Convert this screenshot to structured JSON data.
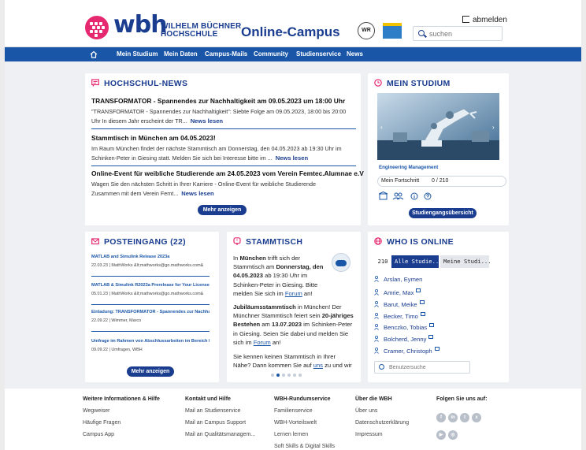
{
  "header": {
    "logo_text": "wbh",
    "logo_sub_line1": "WILHELM BÜCHNER",
    "logo_sub_line2": "HOCHSCHULE",
    "campus_title": "Online-Campus",
    "wr_badge": "WR",
    "logout_label": "abmelden",
    "search_placeholder": "suchen"
  },
  "nav": {
    "items": [
      "Mein Studium",
      "Mein Daten",
      "Campus-Mails",
      "Community",
      "Studienservice",
      "News"
    ]
  },
  "news": {
    "title": "HOCHSCHUL-NEWS",
    "items": [
      {
        "headline": "TRANSFORMATOR - Spannendes zur Nachhaltigkeit am 09.05.2023 um 18:00 Uhr",
        "line1": "\"TRANSFORMATOR - Spannendes zur Nachhaltigkeit\": Siebte Folge am 09.05.2023, 18:00 bis 20:00",
        "line2": "Uhr In diesem Jahr erscheint der TR...",
        "link": "News lesen"
      },
      {
        "headline": "Stammtisch in München am 04.05.2023!",
        "line1": "Im Raum München findet der nächste Stammtisch am Donnerstag, den 04.05.2023 ab 19:30 Uhr im",
        "line2": "Schinken-Peter in Giesing statt. Melden Sie sich bei Interesse bitte im ...",
        "link": "News lesen"
      },
      {
        "headline": "Online-Event für weibliche Studierende am 24.05.2023 vom Verein Femtec.Alumnae e.V",
        "line1": "Wagen Sie den nächsten Schritt in Ihrer Karriere - Online-Event für weibliche Studierende",
        "line2": "Zusammen mit dem Verein Femt...",
        "link": "News lesen"
      }
    ],
    "more_button": "Mehr anzeigen"
  },
  "studium": {
    "title": "MEIN STUDIUM",
    "program": "Engineering Management",
    "progress_label": "Mein Fortschritt",
    "progress_value": "0 / 210",
    "progress_fraction": 0.0,
    "overview_button": "Studiengangsübersicht"
  },
  "mail": {
    "title": "POSTEINGANG (22)",
    "items": [
      {
        "subject": "MATLAB and Simulink Release 2023a",
        "meta": "22.03.23 | MathWorks &lt;mathworks@go.mathworks.com&"
      },
      {
        "subject": "MATLAB & Simulink R2023a Prerelease for Your License",
        "meta": "05.01.23 | MathWorks &lt;mathworks@go.mathworks.com&"
      },
      {
        "subject": "Einladung: TRANSFORMATOR - Spannendes zur Nachhalt...",
        "meta": "22.09.22 | Wimmer, Marco"
      },
      {
        "subject": "Umfrage im Rahmen von Abschlussarbeiten im Bereich I...",
        "meta": "09.09.22 | Umfragen, WBH"
      }
    ],
    "more_button": "Mehr anzeigen"
  },
  "stammtisch": {
    "title": "STAMMTISCH",
    "p1_a": "In ",
    "p1_city": "München",
    "p1_b": " trifft sich der Stammtisch am ",
    "p1_date": "Donnerstag, den 04.05.2023",
    "p1_c": " ab 19:30 Uhr im Schinken-Peter in Giesing. Bitte melden Sie sich im ",
    "p1_link": "Forum",
    "p1_d": " an!",
    "p2_a": "Jubiläumsstammtisch",
    "p2_b": " in München! Der Münchner Stammtisch feiert sein ",
    "p2_c": "20-jähriges Bestehen",
    "p2_d": " am ",
    "p2_date": "13.07.2023",
    "p2_e": " im Schinken-Peter in Giesing. Seien Sie dabei und melden Sie sich im ",
    "p2_link": "Forum",
    "p2_f": " an!",
    "p3_a": "Sie kennen keinen Stammtisch in Ihrer Nähe? Dann kommen Sie auf ",
    "p3_link": "uns",
    "p3_b": " zu und wir"
  },
  "online": {
    "title": "WHO IS ONLINE",
    "count": "210",
    "tab_all": "Alle Studie...",
    "tab_mine": "Meine Studi...",
    "users": [
      "Arslan, Eymen",
      "Amrie, Max",
      "Barut, Meike",
      "Becker, Timo",
      "Benczko, Tobias",
      "Bolcherd, Jenny",
      "Cramer, Christoph"
    ],
    "search_placeholder": "Benutzersuche"
  },
  "footer": {
    "col1": {
      "heading": "Weitere Informationen & Hilfe",
      "links": [
        "Wegweiser",
        "Häufige Fragen",
        "Campus App"
      ]
    },
    "col2": {
      "heading": "Kontakt und Hilfe",
      "links": [
        "Mail an Studienservice",
        "Mail an Campus Support",
        "Mail an Qualitätsmanagem..."
      ]
    },
    "col3": {
      "heading": "WBH-Rundumservice",
      "links": [
        "Familienservice",
        "WBH-Vorteilswelt",
        "Lernen lernen",
        "Soft Skills & Digital Skills"
      ]
    },
    "col4": {
      "heading": "Über die WBH",
      "links": [
        "Über uns",
        "Datenschutzerklärung",
        "Impressum"
      ]
    },
    "col5": {
      "heading": "Folgen Sie uns auf:"
    }
  },
  "colors": {
    "brand_blue": "#1a3d8f",
    "nav_blue": "#1a56a7",
    "logo_pink": "#e5286f"
  }
}
